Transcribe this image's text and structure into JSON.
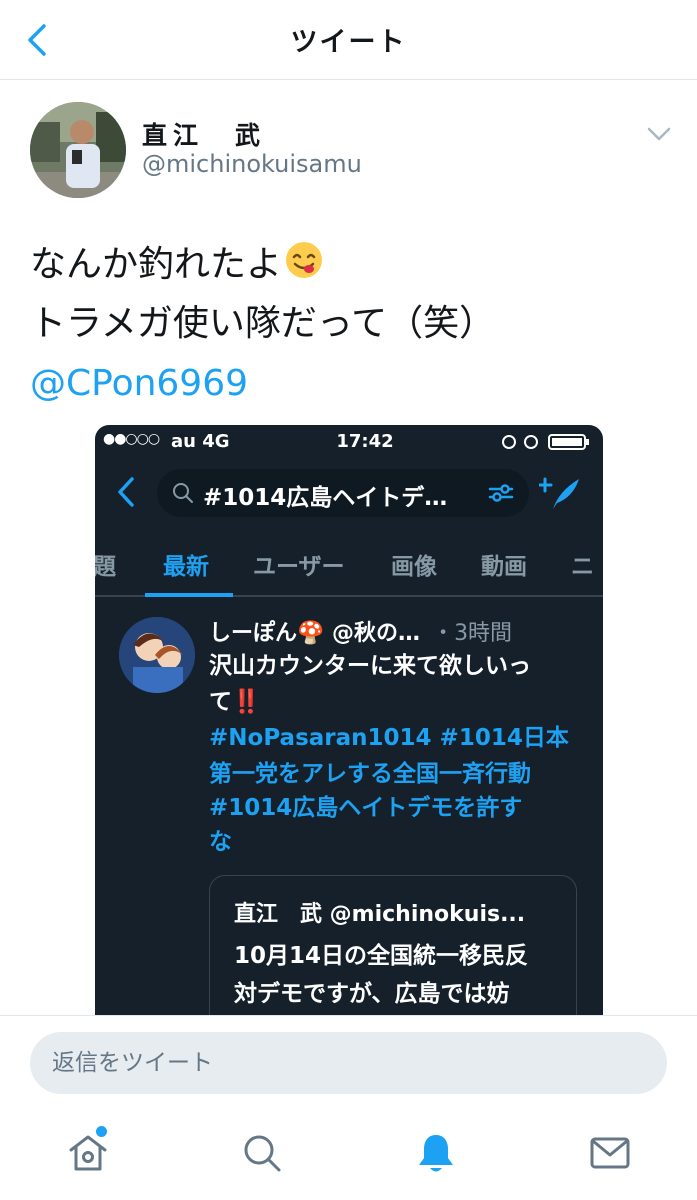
{
  "header": {
    "title": "ツイート",
    "back_icon": "chevron-left-icon"
  },
  "tweet": {
    "author_name": "直江　武",
    "author_handle": "@michinokuisamu",
    "lines": [
      "なんか釣れたよ",
      "トラメガ使い隊だって（笑）"
    ],
    "emoji": "yum-face-emoji",
    "mention": "@CPon6969"
  },
  "embedded_screenshot": {
    "status_bar": {
      "signal": "●●○○○",
      "carrier": "au  4G",
      "time": "17:42"
    },
    "search_text": "#1014広島ヘイトデ…",
    "tabs": [
      "題",
      "最新",
      "ユーザー",
      "画像",
      "動画",
      "ニ"
    ],
    "active_tab": "最新",
    "tweet": {
      "author": "しーぽん🍄 @秋の…",
      "time": "・3時間",
      "lines": [
        "沢山カウンターに来て欲しいっ",
        "て‼️"
      ],
      "hashtag_lines": [
        "#NoPasaran1014 #1014日本",
        "第一党をアレする全国一斉行動",
        "#1014広島ヘイトデモを許す",
        "な"
      ]
    },
    "quote": {
      "head": "直江　武 @michinokuis...",
      "lines": [
        "10月14日の全国統一移民反",
        "対デモですが、広島では妨"
      ]
    }
  },
  "reply": {
    "placeholder": "返信をツイート"
  },
  "tabbar": {
    "items": [
      "home-icon",
      "search-icon",
      "notifications-icon",
      "messages-icon"
    ],
    "active": "notifications-icon",
    "accent": "#1da1f2",
    "inactive": "#657786"
  }
}
